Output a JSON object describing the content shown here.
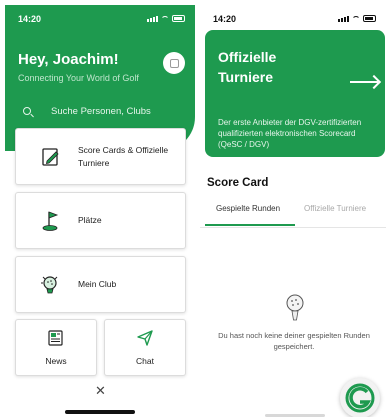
{
  "left": {
    "status_time": "14:20",
    "greeting": "Hey, Joachim!",
    "tagline": "Connecting Your World of Golf",
    "search_placeholder": "Suche Personen, Clubs",
    "cards": {
      "scorecards": "Score Cards & Offizielle Turniere",
      "plaetze": "Plätze",
      "mein_club": "Mein Club",
      "news": "News",
      "chat": "Chat"
    },
    "close_symbol": "✕"
  },
  "right": {
    "status_time": "14:20",
    "banner_title": "Offizielle Turniere",
    "banner_text": "Der erste Anbieter der DGV-zertifizierten qualifizierten elektronischen Scorecard (QeSC / DGV)",
    "section_title": "Score Card",
    "tabs": [
      "Gespielte Runden",
      "Offizielle Turniere"
    ],
    "empty_message": "Du hast noch keine deiner gespielten Runden gespeichert."
  },
  "colors": {
    "brand_green": "#1e9a4f",
    "tab_inactive": "#a8a8a8"
  },
  "icons": [
    "search-icon",
    "profile-icon",
    "scorecard-icon",
    "golf-flag-icon",
    "club-icon",
    "news-icon",
    "chat-send-icon",
    "close-icon",
    "arrow-right-icon",
    "golf-ball-icon",
    "app-logo"
  ]
}
